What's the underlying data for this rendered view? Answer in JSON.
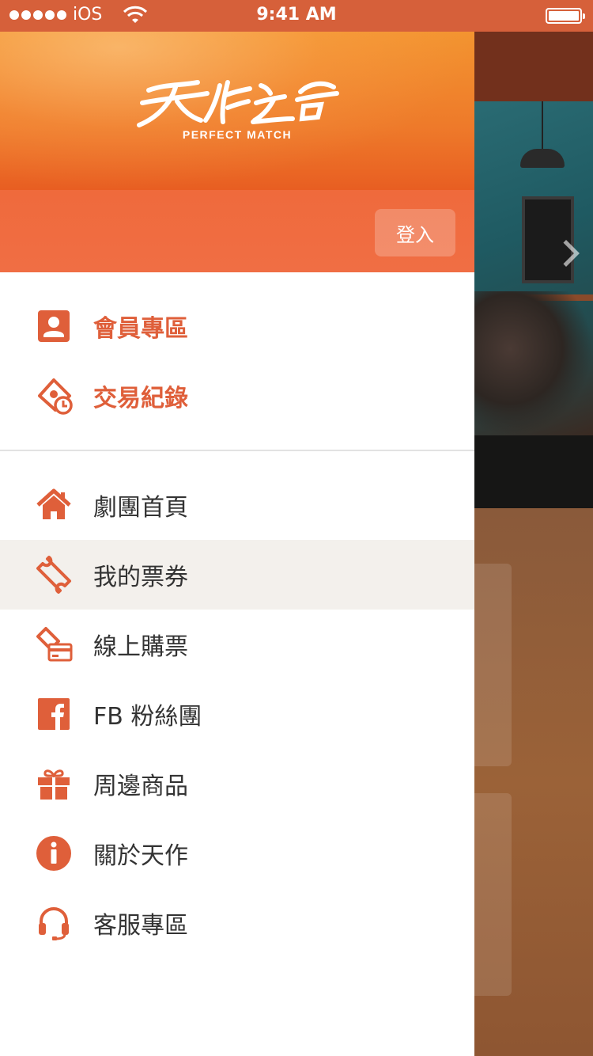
{
  "status_bar": {
    "carrier": "iOS",
    "time": "9:41 AM",
    "signal_dots": 5
  },
  "colors": {
    "accent": "#df5f3a",
    "status_bar": "#d6603a",
    "selected_row": "#f3f0ec"
  },
  "header": {
    "logo_sub": "PERFECT MATCH",
    "login_label": "登入"
  },
  "member_menu": [
    {
      "label": "會員專區",
      "icon": "member-card-icon"
    },
    {
      "label": "交易紀錄",
      "icon": "transaction-history-icon"
    }
  ],
  "main_menu": [
    {
      "label": "劇團首頁",
      "icon": "home-icon"
    },
    {
      "label": "我的票券",
      "icon": "ticket-icon",
      "selected": true
    },
    {
      "label": "線上購票",
      "icon": "buy-ticket-card-icon"
    },
    {
      "label": "FB 粉絲團",
      "icon": "facebook-icon"
    },
    {
      "label": "周邊商品",
      "icon": "gift-icon"
    },
    {
      "label": "關於天作",
      "icon": "info-icon"
    },
    {
      "label": "客服專區",
      "icon": "headset-icon"
    }
  ]
}
